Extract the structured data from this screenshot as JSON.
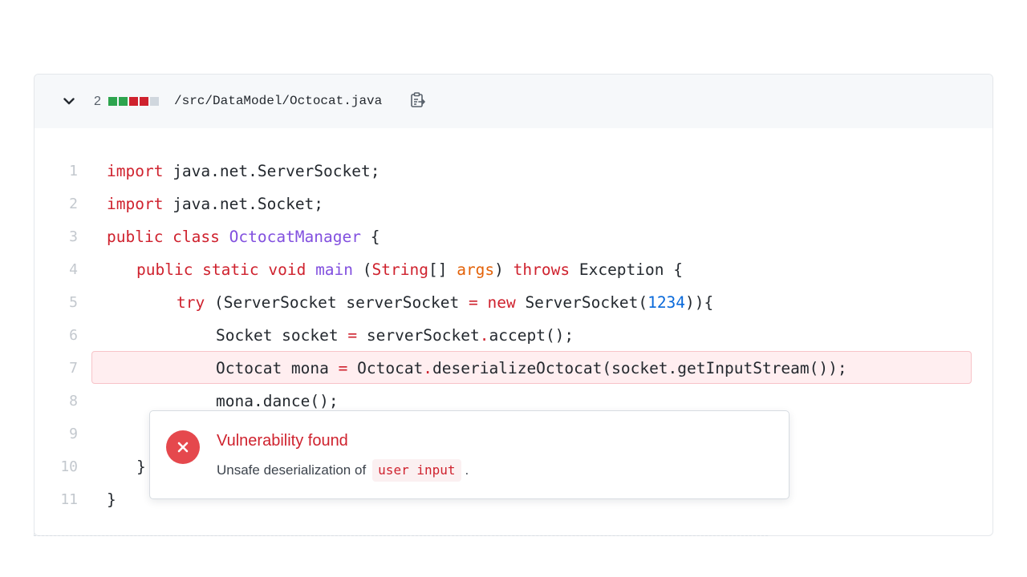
{
  "file": {
    "changes_count": "2",
    "path": "/src/DataModel/Octocat.java",
    "diffstat_colors": [
      "#2da44e",
      "#2da44e",
      "#cf222e",
      "#cf222e",
      "#d0d7de"
    ]
  },
  "code_lines": [
    {
      "n": "1",
      "indent": 0,
      "tokens": [
        {
          "t": "import",
          "c": "kw"
        },
        {
          "t": " java.net.ServerSocket;",
          "c": ""
        }
      ]
    },
    {
      "n": "2",
      "indent": 0,
      "tokens": [
        {
          "t": "import",
          "c": "kw"
        },
        {
          "t": " java.net.Socket;",
          "c": ""
        }
      ]
    },
    {
      "n": "3",
      "indent": 0,
      "tokens": [
        {
          "t": "public class ",
          "c": "kw"
        },
        {
          "t": "OctocatManager",
          "c": "cls"
        },
        {
          "t": " {",
          "c": ""
        }
      ]
    },
    {
      "n": "4",
      "indent": 1,
      "tokens": [
        {
          "t": "public static void ",
          "c": "kw"
        },
        {
          "t": "main",
          "c": "fn"
        },
        {
          "t": " (",
          "c": ""
        },
        {
          "t": "String",
          "c": "str"
        },
        {
          "t": "[] ",
          "c": ""
        },
        {
          "t": "args",
          "c": "prm"
        },
        {
          "t": ") ",
          "c": ""
        },
        {
          "t": "throws",
          "c": "kw"
        },
        {
          "t": " Exception {",
          "c": ""
        }
      ]
    },
    {
      "n": "5",
      "indent": 2,
      "tokens": [
        {
          "t": "try",
          "c": "kw"
        },
        {
          "t": " (ServerSocket serverSocket ",
          "c": ""
        },
        {
          "t": "=",
          "c": "kw"
        },
        {
          "t": " ",
          "c": ""
        },
        {
          "t": "new",
          "c": "kw"
        },
        {
          "t": " ServerSocket(",
          "c": ""
        },
        {
          "t": "1234",
          "c": "num"
        },
        {
          "t": ")){",
          "c": ""
        }
      ]
    },
    {
      "n": "6",
      "indent": 3,
      "tokens": [
        {
          "t": "Socket socket ",
          "c": ""
        },
        {
          "t": "=",
          "c": "kw"
        },
        {
          "t": " serverSocket",
          "c": ""
        },
        {
          "t": ".",
          "c": "dot"
        },
        {
          "t": "accept();",
          "c": ""
        }
      ]
    },
    {
      "n": "7",
      "indent": 3,
      "tokens": [
        {
          "t": "Octocat mona ",
          "c": ""
        },
        {
          "t": "=",
          "c": "kw"
        },
        {
          "t": " Octocat",
          "c": ""
        },
        {
          "t": ".",
          "c": "dot"
        },
        {
          "t": "deserializeOctocat(socket.getInputStream());",
          "c": ""
        }
      ]
    },
    {
      "n": "8",
      "indent": 3,
      "tokens": [
        {
          "t": "mona.dance();",
          "c": ""
        }
      ]
    },
    {
      "n": "9",
      "indent": 0,
      "tokens": []
    },
    {
      "n": "10",
      "indent": 1,
      "tokens": [
        {
          "t": "}",
          "c": ""
        }
      ]
    },
    {
      "n": "11",
      "indent": 0,
      "tokens": [
        {
          "t": "}",
          "c": ""
        }
      ]
    }
  ],
  "highlighted_line": "7",
  "alert": {
    "title": "Vulnerability found",
    "desc_prefix": "Unsafe deserialization of",
    "desc_code": "user input",
    "desc_suffix": "."
  }
}
